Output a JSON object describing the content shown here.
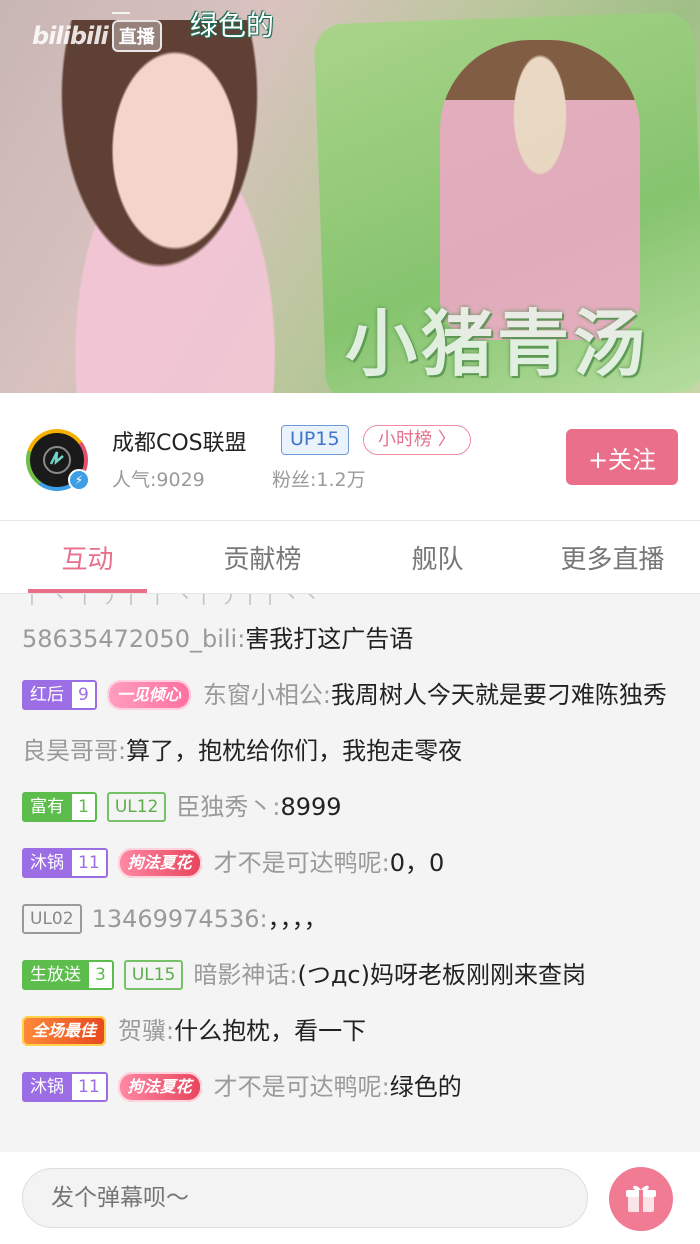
{
  "video": {
    "logo_text": "bilibili",
    "live_label": "直播",
    "danmaku": "绿色的",
    "pillow_text": "小猪青汤"
  },
  "room": {
    "name": "成都COS联盟",
    "up_badge": "UP15",
    "rank_badge": "小时榜 〉",
    "popularity": "人气:9029",
    "fans": "粉丝:1.2万",
    "follow_label": "+关注"
  },
  "tabs": [
    "互动",
    "贡献榜",
    "舰队",
    "更多直播"
  ],
  "chat": {
    "cut_line": "丨  丶 丨 丿丨 丨 丶丨 丿丨丨丶丶",
    "messages": [
      {
        "user": "58635472050_bili:",
        "text": "害我打这广告语"
      },
      {
        "medal": "红后",
        "medal_level": "9",
        "title": "一见倾心",
        "user": "东窗小相公:",
        "text": "我周树人今天就是要刁难陈独秀"
      },
      {
        "user": "良昊哥哥:",
        "text": "算了，抱枕给你们，我抱走零夜"
      },
      {
        "medal": "富有",
        "medal_level": "1",
        "ul": "UL12",
        "user": "臣独秀丶:",
        "text": "8999"
      },
      {
        "medal": "沐锅",
        "medal_level": "11",
        "title": "拘法夏花",
        "user": "才不是可达鸭呢:",
        "text": "0，0"
      },
      {
        "ul": "UL02",
        "user": "13469974536:",
        "text": "，，，，"
      },
      {
        "medal": "生放送",
        "medal_level": "3",
        "ul": "UL15",
        "user": "暗影神话:",
        "text": "(つдc)妈呀老板刚刚来查岗"
      },
      {
        "title": "全场最佳",
        "user": "贺骥:",
        "text": "什么抱枕，看一下"
      },
      {
        "medal": "沐锅",
        "medal_level": "11",
        "title": "拘法夏花",
        "user": "才不是可达鸭呢:",
        "text": "绿色的"
      }
    ]
  },
  "input": {
    "placeholder": "发个弹幕呗～"
  },
  "colors": {
    "accent": "#e96f8a",
    "medal_purple": "#9b6ee6",
    "medal_green": "#5cbd4d",
    "up_blue": "#3f76c5"
  },
  "icons": {
    "gift": "gift-icon",
    "verify": "lightning-icon"
  }
}
